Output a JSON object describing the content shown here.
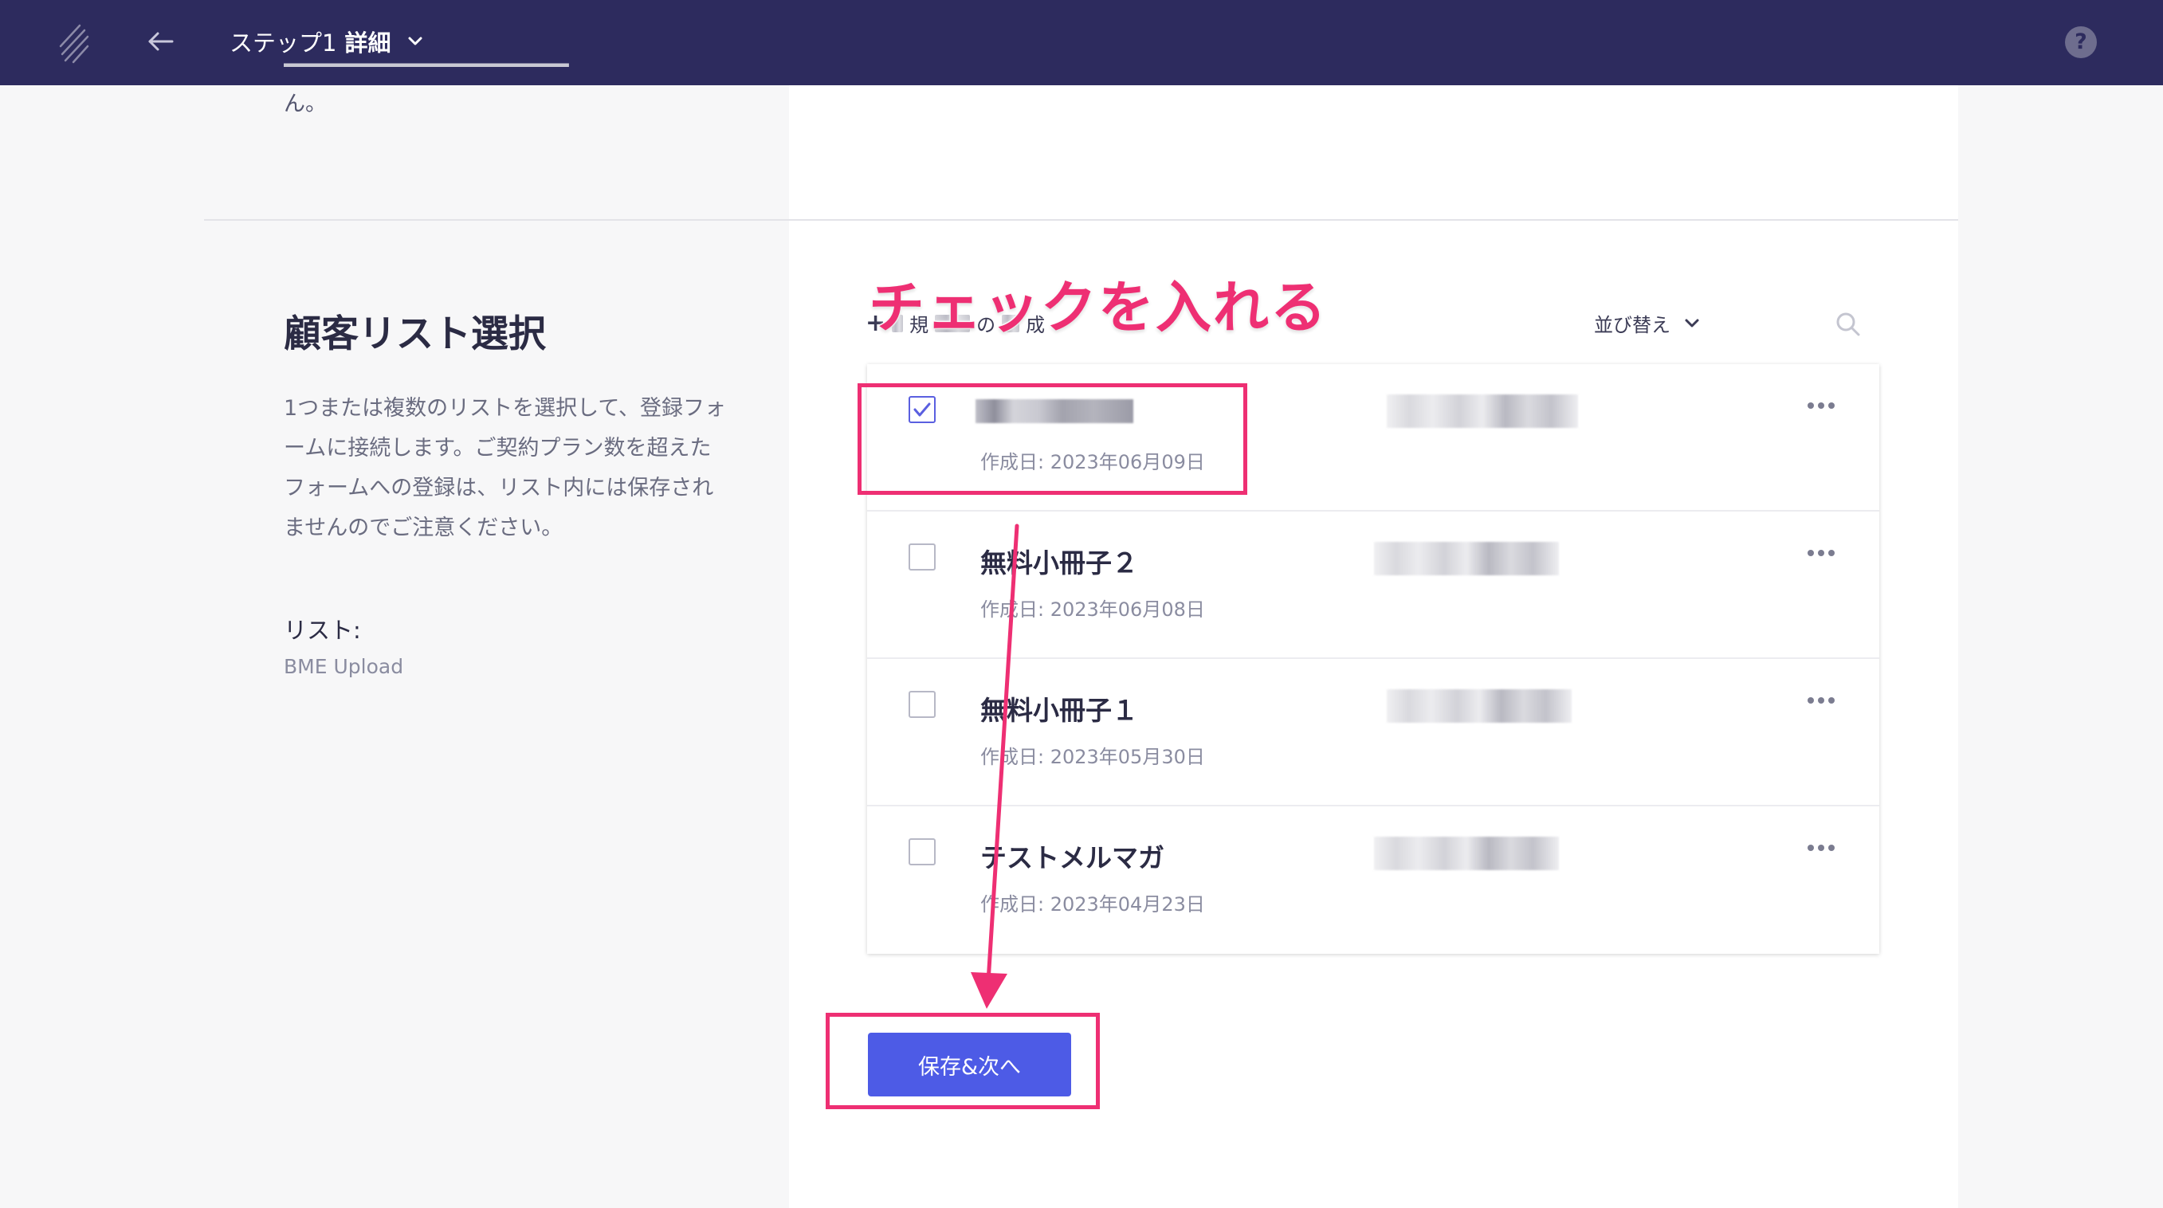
{
  "header": {
    "step_label": "ステップ1",
    "step_detail": "詳細",
    "logo_icon": "brand-slash-logo",
    "back_icon": "arrow-left-icon",
    "help_label": "?"
  },
  "previous_section": {
    "text_fragment": "ん。"
  },
  "section": {
    "title": "顧客リスト選択",
    "description": "1つまたは複数のリストを選択して、登録フォームに接続します。ご契約プラン数を超えたフォームへの登録は、リスト内には保存されませんのでご注意ください。",
    "list_label": "リスト:",
    "list_value": "BME Upload"
  },
  "toolbar": {
    "new_list_plus": "+",
    "new_list_partial_a": "規",
    "new_list_partial_b": "の",
    "new_list_partial_c": "成",
    "sort_label": "並び替え",
    "search_icon": "search-icon"
  },
  "lists": [
    {
      "name": "",
      "date": "作成日: 2023年06月09日",
      "checked": true
    },
    {
      "name": "無料小冊子２",
      "date": "作成日: 2023年06月08日",
      "checked": false
    },
    {
      "name": "無料小冊子１",
      "date": "作成日: 2023年05月30日",
      "checked": false
    },
    {
      "name": "テストメルマガ",
      "date": "作成日: 2023年04月23日",
      "checked": false
    }
  ],
  "save_button": "保存&次へ",
  "annotation": {
    "text": "チェックを入れる",
    "color": "#ee2f73"
  },
  "colors": {
    "topbar": "#2d2b5e",
    "primary": "#4d5be6",
    "checkbox_checked": "#5a5fe0"
  }
}
